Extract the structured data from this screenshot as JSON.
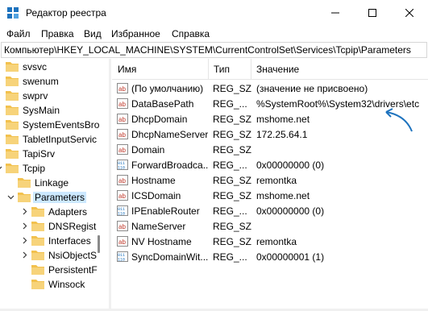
{
  "window": {
    "title": "Редактор реестра",
    "buttons": {
      "minimize": "minimize-icon",
      "maximize": "maximize-icon",
      "close": "close-icon"
    }
  },
  "menu": [
    "Файл",
    "Правка",
    "Вид",
    "Избранное",
    "Справка"
  ],
  "address": "Компьютер\\HKEY_LOCAL_MACHINE\\SYSTEM\\CurrentControlSet\\Services\\Tcpip\\Parameters",
  "tree": [
    {
      "label": "svsvc",
      "level": 1
    },
    {
      "label": "swenum",
      "level": 1
    },
    {
      "label": "swprv",
      "level": 1
    },
    {
      "label": "SysMain",
      "level": 1
    },
    {
      "label": "SystemEventsBro",
      "level": 1
    },
    {
      "label": "TabletInputServic",
      "level": 1
    },
    {
      "label": "TapiSrv",
      "level": 1
    },
    {
      "label": "Tcpip",
      "level": 1,
      "expanded": true
    },
    {
      "label": "Linkage",
      "level": 2
    },
    {
      "label": "Parameters",
      "level": 2,
      "expanded": true,
      "selected": true
    },
    {
      "label": "Adapters",
      "level": 3,
      "collapsed": true
    },
    {
      "label": "DNSRegist",
      "level": 3,
      "collapsed": true
    },
    {
      "label": "Interfaces",
      "level": 3,
      "collapsed": true
    },
    {
      "label": "NsiObjectS",
      "level": 3,
      "collapsed": true
    },
    {
      "label": "PersistentF",
      "level": 3
    },
    {
      "label": "Winsock",
      "level": 3
    }
  ],
  "columns": {
    "name": "Имя",
    "type": "Тип",
    "data": "Значение"
  },
  "values": [
    {
      "name": "(По умолчанию)",
      "type": "REG_SZ",
      "data": "(значение не присвоено)",
      "icon": "string"
    },
    {
      "name": "DataBasePath",
      "type": "REG_...",
      "data": "%SystemRoot%\\System32\\drivers\\etc",
      "icon": "string"
    },
    {
      "name": "DhcpDomain",
      "type": "REG_SZ",
      "data": "mshome.net",
      "icon": "string"
    },
    {
      "name": "DhcpNameServer",
      "type": "REG_SZ",
      "data": "172.25.64.1",
      "icon": "string"
    },
    {
      "name": "Domain",
      "type": "REG_SZ",
      "data": "",
      "icon": "string"
    },
    {
      "name": "ForwardBroadca...",
      "type": "REG_...",
      "data": "0x00000000 (0)",
      "icon": "binary"
    },
    {
      "name": "Hostname",
      "type": "REG_SZ",
      "data": "remontka",
      "icon": "string"
    },
    {
      "name": "ICSDomain",
      "type": "REG_SZ",
      "data": "mshome.net",
      "icon": "string"
    },
    {
      "name": "IPEnableRouter",
      "type": "REG_...",
      "data": "0x00000000 (0)",
      "icon": "binary"
    },
    {
      "name": "NameServer",
      "type": "REG_SZ",
      "data": "",
      "icon": "string"
    },
    {
      "name": "NV Hostname",
      "type": "REG_SZ",
      "data": "remontka",
      "icon": "string"
    },
    {
      "name": "SyncDomainWit...",
      "type": "REG_...",
      "data": "0x00000001 (1)",
      "icon": "binary"
    }
  ],
  "colors": {
    "accent_arrow": "#1e73be",
    "folder": "#f2c14e",
    "selected": "#cce8ff"
  }
}
